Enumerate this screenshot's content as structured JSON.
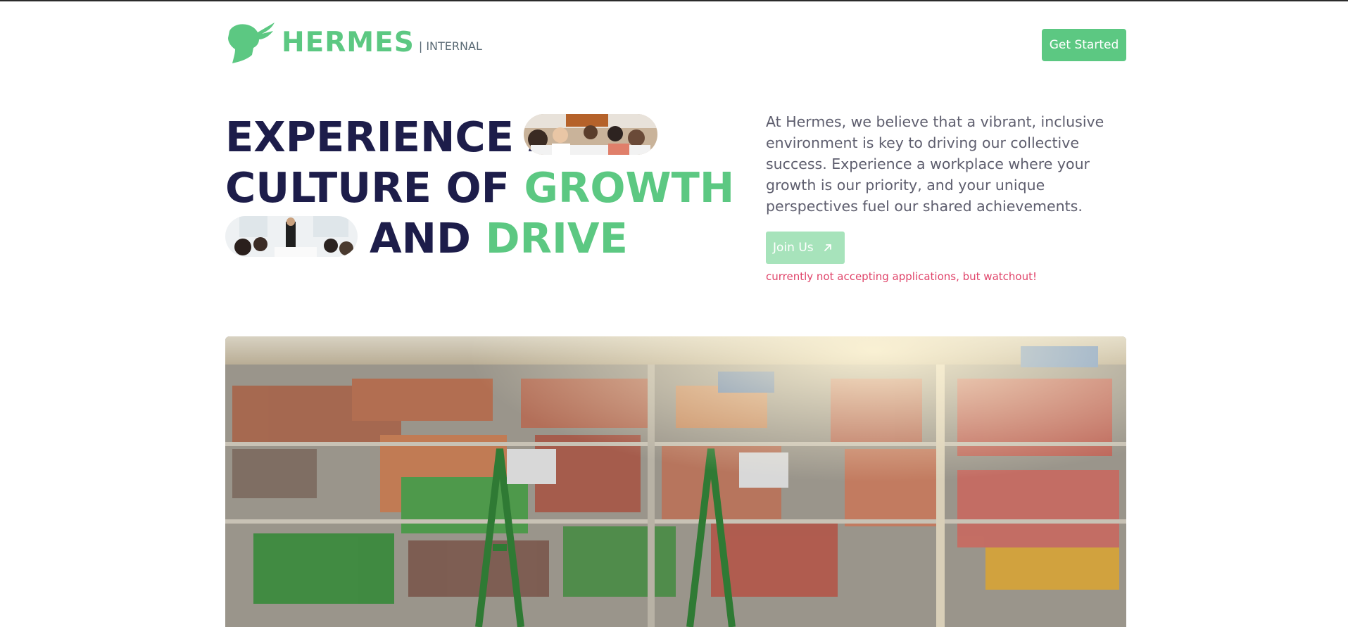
{
  "header": {
    "brand": "HERMES",
    "brand_suffix": "| INTERNAL",
    "cta_label": "Get Started"
  },
  "hero": {
    "line1": "EXPERIENCE A",
    "line2_prefix": "CULTURE OF",
    "line2_highlight": "GROWTH",
    "line3_prefix": "AND",
    "line3_highlight": "DRIVE",
    "description": "At Hermes, we believe that a vibrant, inclusive environment is key to driving our collective success. Experience a workplace where your growth is our priority, and your unique perspectives fuel our shared achievements.",
    "join_label": "Join Us",
    "notice": "currently not accepting applications, but watchout!"
  },
  "colors": {
    "brand_green": "#5cc882",
    "navy": "#1d1d4a",
    "notice_red": "#e0446a",
    "join_disabled": "#a7e3bb"
  },
  "icons": {
    "logo": "winged-head-icon",
    "join_arrow": "arrow-up-right-icon"
  }
}
